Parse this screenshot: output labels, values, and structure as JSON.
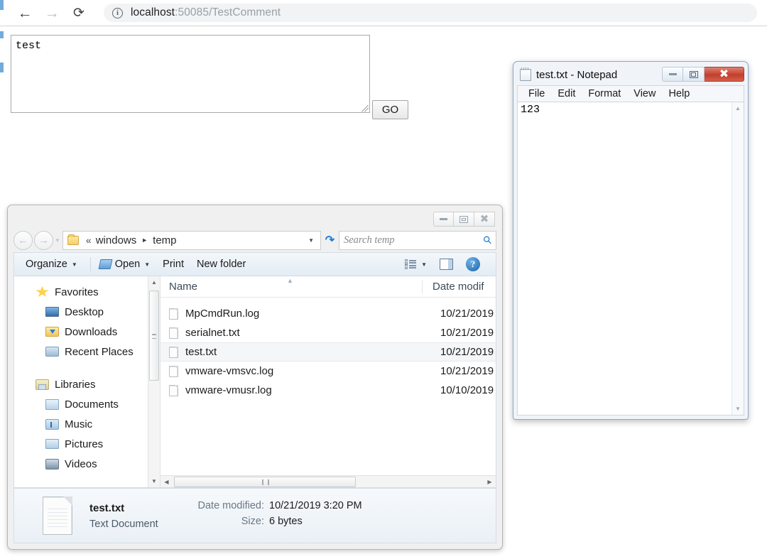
{
  "browser": {
    "back_icon": "arrow-left-icon",
    "forward_icon": "arrow-right-icon",
    "reload_icon": "reload-icon",
    "site_info_icon": "info-circle-icon",
    "url_host": "localhost",
    "url_rest": ":50085/TestComment",
    "url_full": "localhost:50085/TestComment"
  },
  "page": {
    "textarea_value": "test",
    "textarea_placeholder": "",
    "go_label": "GO"
  },
  "explorer": {
    "window_buttons": {
      "minimize": "minimize-icon",
      "maximize": "maximize-icon",
      "close": "close-icon"
    },
    "address": {
      "back_icon": "back-circle-icon",
      "forward_icon": "forward-circle-icon",
      "history_icon": "chevron-down-icon",
      "folder_icon": "folder-icon",
      "overflow": "«",
      "crumb1": "windows",
      "crumb_arrow": "▸",
      "crumb2": "temp",
      "dropdown_icon": "chevron-down-icon",
      "refresh_icon": "refresh-icon",
      "search_placeholder": "Search temp",
      "search_value": "",
      "search_icon": "search-icon"
    },
    "toolbar": {
      "organize": "Organize",
      "open": "Open",
      "print": "Print",
      "new_folder": "New folder",
      "view_icon": "list-view-icon",
      "preview_icon": "preview-pane-icon",
      "help_icon": "help-icon"
    },
    "nav_pane": {
      "groups": [
        {
          "label": "Favorites",
          "icon": "star-icon",
          "children": [
            {
              "label": "Desktop",
              "icon": "desktop-icon"
            },
            {
              "label": "Downloads",
              "icon": "downloads-icon"
            },
            {
              "label": "Recent Places",
              "icon": "recent-places-icon"
            }
          ]
        },
        {
          "label": "Libraries",
          "icon": "libraries-icon",
          "children": [
            {
              "label": "Documents",
              "icon": "documents-icon"
            },
            {
              "label": "Music",
              "icon": "music-icon"
            },
            {
              "label": "Pictures",
              "icon": "pictures-icon"
            },
            {
              "label": "Videos",
              "icon": "videos-icon"
            }
          ]
        }
      ]
    },
    "columns": {
      "name": "Name",
      "date": "Date modif"
    },
    "files": [
      {
        "name": "MpCmdRun.log",
        "date": "10/21/2019",
        "selected": false
      },
      {
        "name": "serialnet.txt",
        "date": "10/21/2019",
        "selected": false
      },
      {
        "name": "test.txt",
        "date": "10/21/2019",
        "selected": true
      },
      {
        "name": "vmware-vmsvc.log",
        "date": "10/21/2019",
        "selected": false
      },
      {
        "name": "vmware-vmusr.log",
        "date": "10/10/2019",
        "selected": false
      }
    ],
    "details": {
      "file_name": "test.txt",
      "file_type": "Text Document",
      "date_key": "Date modified:",
      "date_value": "10/21/2019 3:20 PM",
      "size_key": "Size:",
      "size_value": "6 bytes"
    }
  },
  "notepad": {
    "title": "test.txt - Notepad",
    "icon": "notepad-icon",
    "menu": [
      "File",
      "Edit",
      "Format",
      "View",
      "Help"
    ],
    "content": "123",
    "window_buttons": {
      "minimize": "minimize-icon",
      "maximize": "maximize-icon",
      "close": "close-icon"
    }
  },
  "colors": {
    "notepad_close_red": "#c23f2c",
    "notepad_border_blue": "#8aa9c9",
    "selection_gray": "#f4f6f8",
    "omnibox_gray": "#f1f3f4",
    "url_host_dark": "#202124",
    "url_rest_gray": "#9aa0a6"
  }
}
